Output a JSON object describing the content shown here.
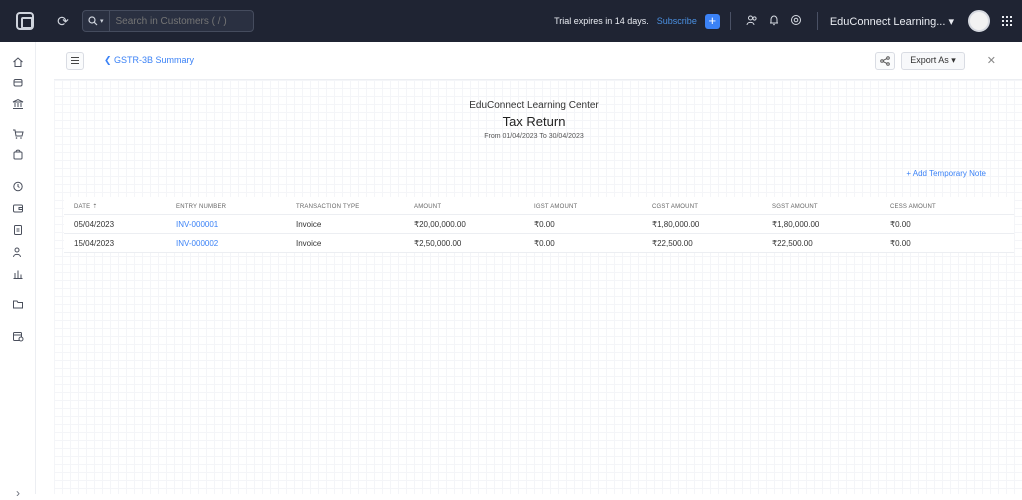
{
  "topbar": {
    "search_placeholder": "Search in Customers ( / )",
    "trial_text": "Trial expires in 14 days.",
    "subscribe_label": "Subscribe",
    "org_label": "EduConnect Learning... ▾"
  },
  "subheader": {
    "back_label": "❮ GSTR-3B Summary",
    "export_label": "Export As ▾"
  },
  "report": {
    "org_name": "EduConnect Learning Center",
    "title": "Tax Return",
    "period": "From 01/04/2023 To 30/04/2023",
    "add_note_label": "+ Add Temporary Note"
  },
  "table": {
    "headers": [
      "DATE ⇡",
      "ENTRY NUMBER",
      "TRANSACTION TYPE",
      "AMOUNT",
      "IGST AMOUNT",
      "CGST AMOUNT",
      "SGST AMOUNT",
      "CESS AMOUNT"
    ],
    "rows": [
      [
        "05/04/2023",
        "INV-000001",
        "Invoice",
        "₹20,00,000.00",
        "₹0.00",
        "₹1,80,000.00",
        "₹1,80,000.00",
        "₹0.00"
      ],
      [
        "15/04/2023",
        "INV-000002",
        "Invoice",
        "₹2,50,000.00",
        "₹0.00",
        "₹22,500.00",
        "₹22,500.00",
        "₹0.00"
      ]
    ]
  },
  "icons": {
    "sidebar": [
      "home-icon",
      "cube-icon",
      "bank-icon",
      "cart-icon",
      "bag-icon",
      "clock-icon",
      "wallet-icon",
      "document-icon",
      "users-icon",
      "chart-icon",
      "folder-icon",
      "calendar-icon"
    ]
  }
}
